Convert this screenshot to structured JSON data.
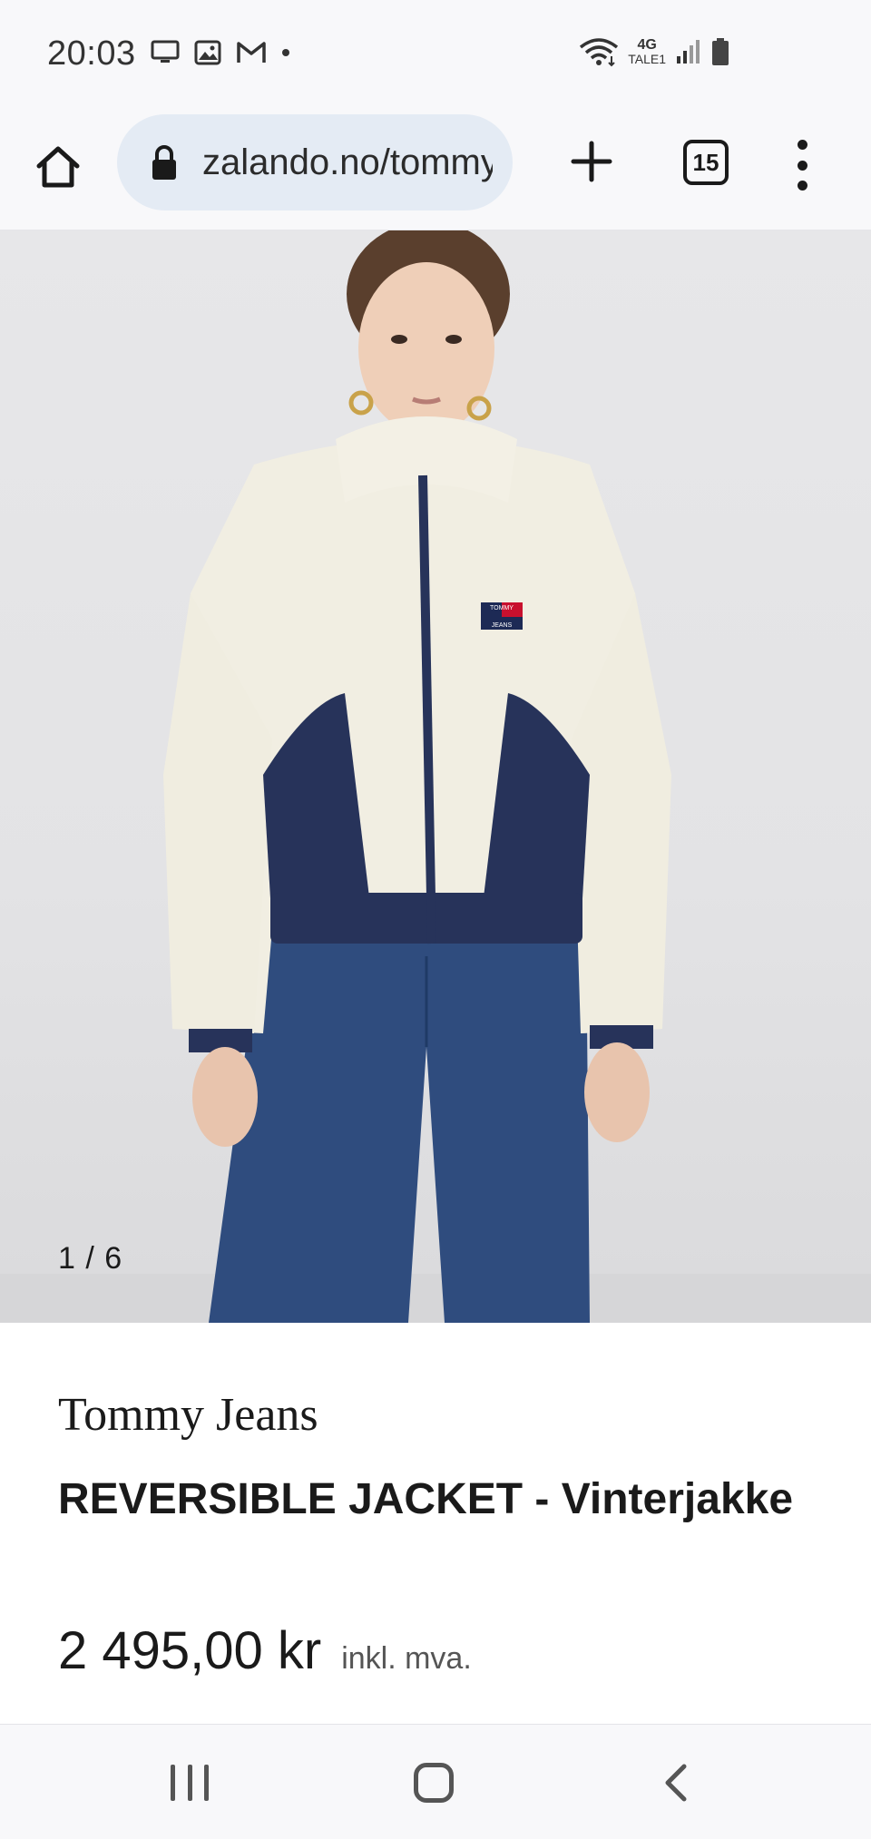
{
  "status_bar": {
    "time": "20:03",
    "left_icons": [
      "monitor-icon",
      "image-icon",
      "gmail-icon",
      "dot-icon"
    ],
    "right_icons": [
      "wifi-icon",
      "network-4g-icon",
      "signal-icon",
      "battery-icon"
    ],
    "network_label_top": "4G",
    "network_label_bottom": "TALE1"
  },
  "browser": {
    "url": "zalando.no/tommy-jeans",
    "tab_count": "15",
    "icons": [
      "home-icon",
      "lock-icon",
      "plus-icon",
      "more-vert-icon"
    ]
  },
  "product": {
    "image_counter": "1 / 6",
    "brand": "Tommy Jeans",
    "name": "REVERSIBLE JACKET - Vinterjakke",
    "price": "2 495,00 kr",
    "vat_note": "inkl. mva.",
    "badge_line1": "TOMMY",
    "badge_line2": "JEANS"
  },
  "nav_bar": {
    "icons": [
      "recent-apps-icon",
      "home-circle-icon",
      "back-icon"
    ]
  },
  "colors": {
    "jacket_fleece": "#f1eee2",
    "jacket_navy": "#27335a",
    "denim": "#2f4c7e",
    "url_pill": "#e4ebf4",
    "status_bg": "#f8f8fa"
  }
}
